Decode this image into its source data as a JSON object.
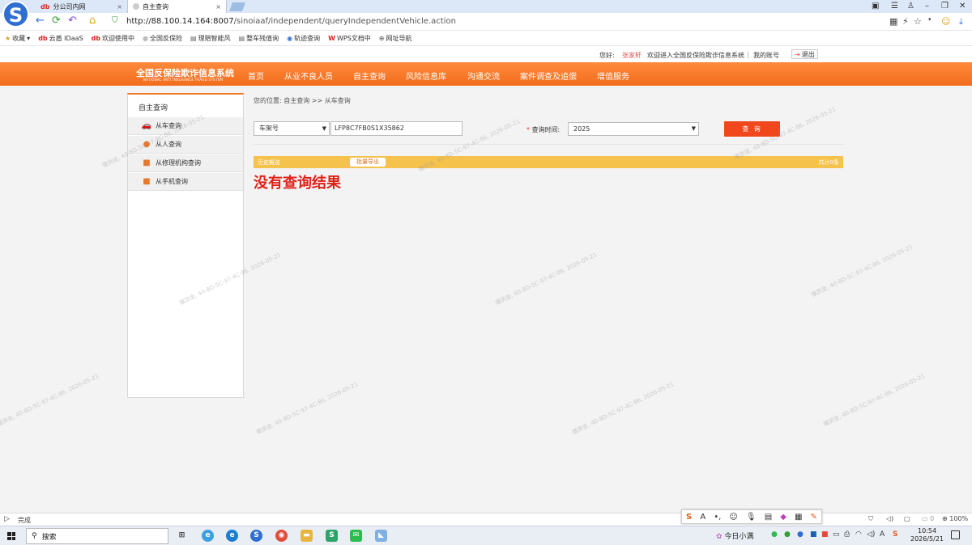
{
  "browser": {
    "tabs": [
      {
        "label": "分公司内网",
        "icon": "db",
        "close": "×"
      },
      {
        "label": "自主查询",
        "close": "×"
      }
    ],
    "url_host": "http://88.100.14.164:8007",
    "url_path": "/sinoiaaf/independent/queryIndependentVehicle.action",
    "bookmarks": [
      {
        "label": "收藏",
        "icon": "star-icon"
      },
      {
        "label": "云盾 IDaaS",
        "icon": "db-icon"
      },
      {
        "label": "欢迎使用中",
        "icon": "db-icon"
      },
      {
        "label": "全国反保险",
        "icon": "globe-icon"
      },
      {
        "label": "理赔智能风",
        "icon": "doc-icon"
      },
      {
        "label": "整车残值询",
        "icon": "doc-icon"
      },
      {
        "label": "轨迹查询",
        "icon": "logo-icon"
      },
      {
        "label": "WPS文档中",
        "icon": "wps-icon"
      },
      {
        "label": "网址导航",
        "icon": "globe-icon"
      }
    ]
  },
  "site": {
    "greeting": "您好:",
    "user": "张家轩",
    "welcome": "欢迎进入全国反保险欺诈信息系统",
    "separator": "|",
    "my_account": "我的账号",
    "logout": "退出",
    "logo_title": "全国反保险欺诈信息系统",
    "logo_sub": "NATIONAL ANTI INSURANCE FRAUD SYSTEM",
    "nav": [
      "首页",
      "从业不良人员",
      "自主查询",
      "风险信息库",
      "沟通交流",
      "案件调查及追偿",
      "增值服务"
    ]
  },
  "sidebar": {
    "title": "自主查询",
    "items": [
      "从车查询",
      "从人查询",
      "从修理机构查询",
      "从手机查询"
    ]
  },
  "main": {
    "breadcrumb": "您的位置: 自主查询 >> 从车查询",
    "field_type": "车架号",
    "vin": "LFP8C7FB0S1X35862",
    "query_time_req": "*",
    "query_time_label": "查询时间:",
    "year": "2025",
    "query_button": "查 询",
    "history_label": "历史概览",
    "export_button": "批量导出",
    "total": "共计0条",
    "no_result": "没有查询结果"
  },
  "status": {
    "text": "完成",
    "zoom": "100%",
    "count": "0"
  },
  "taskbar": {
    "search": "搜索",
    "weather": "今日小满",
    "time": "10:54",
    "date": "2026/5/21"
  },
  "watermark": "播货坐, 40-8D-5C-97-4C-86, 2026-05-21",
  "colors": {
    "accent": "#f26d1c",
    "button": "#f0471d",
    "history_bar": "#f5c24c",
    "no_result": "#e0221b"
  }
}
